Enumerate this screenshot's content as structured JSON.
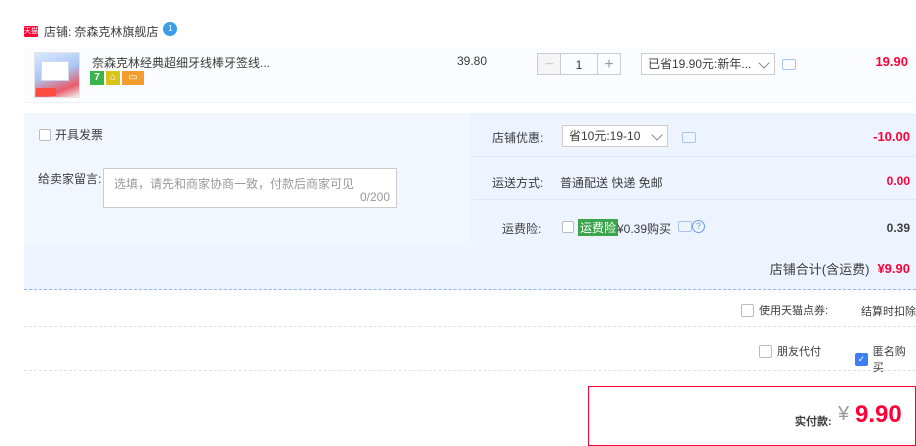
{
  "shop": {
    "badge": "天猫",
    "label": "店铺:",
    "name": "奈森克林旗舰店",
    "chat_badge": "1"
  },
  "item": {
    "title": "奈森克林经典超细牙线棒牙签线...",
    "price": "39.80",
    "quantity": "1",
    "minus": "−",
    "plus": "+",
    "promo": "已省19.90元:新年...",
    "subtotal": "19.90",
    "services": [
      "7",
      "",
      ""
    ]
  },
  "invoice": {
    "label": "开具发票"
  },
  "message": {
    "label": "给卖家留言:",
    "placeholder": "选填，请先和商家协商一致，付款后商家可见",
    "counter": "0/200"
  },
  "shop_discount": {
    "label": "店铺优惠:",
    "value": "省10元:19-10",
    "amount": "-10.00"
  },
  "shipping": {
    "label": "运送方式:",
    "value": "普通配送 快递 免邮",
    "amount": "0.00"
  },
  "insurance": {
    "label": "运费险:",
    "tag": "运费险",
    "desc": "¥0.39购买",
    "amount": "0.39"
  },
  "shop_total": {
    "label": "店铺合计(含运费)",
    "amount": "¥9.90"
  },
  "points": {
    "label": "使用天猫点券:",
    "note": "结算时扣除"
  },
  "friend_pay": {
    "label": "朋友代付"
  },
  "anonymous": {
    "label": "匿名购买"
  },
  "payable": {
    "label": "实付款:",
    "currency": "¥",
    "amount": "9.90"
  },
  "colors": {
    "accent": "#ff0036",
    "panel": "#eef4ff"
  }
}
